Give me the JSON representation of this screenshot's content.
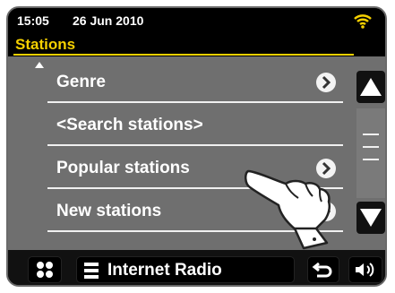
{
  "status": {
    "time": "15:05",
    "date": "26 Jun 2010"
  },
  "header": {
    "title": "Stations"
  },
  "list": {
    "items": [
      {
        "label": "Genre",
        "has_arrow": true
      },
      {
        "label": "<Search stations>",
        "has_arrow": false
      },
      {
        "label": "Popular stations",
        "has_arrow": true
      },
      {
        "label": "New stations",
        "has_arrow": true
      }
    ]
  },
  "bottom": {
    "source_label": "Internet Radio"
  },
  "icons": {
    "wifi": "wifi-icon",
    "scroll_up": "scroll-up-icon",
    "scroll_down": "scroll-down-icon",
    "grid": "grid-menu-icon",
    "source_menu": "menu-lines-icon",
    "back": "back-icon",
    "volume": "volume-icon",
    "pointer": "pointing-hand-icon"
  },
  "colors": {
    "accent": "#f5d000",
    "list_bg": "#6f6f6f",
    "wifi": "#f5d000"
  }
}
